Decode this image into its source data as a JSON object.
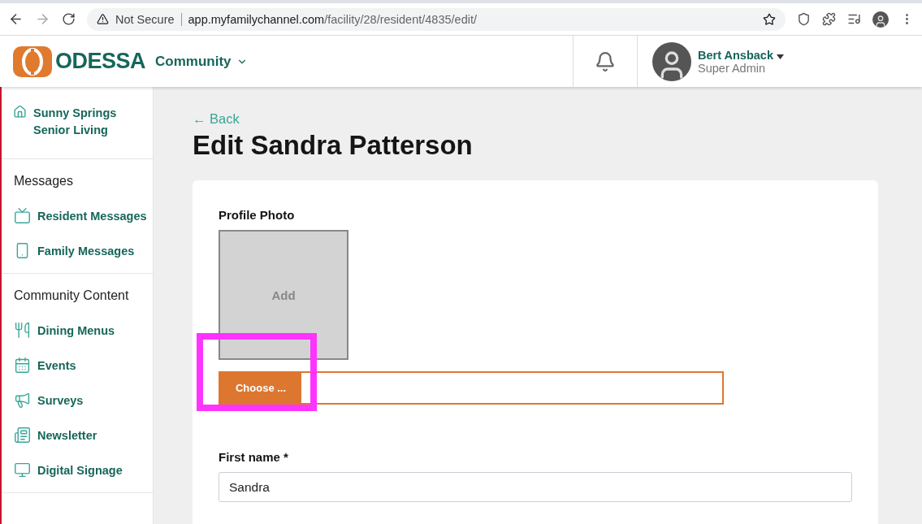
{
  "browser": {
    "security": "Not Secure",
    "url_host": "app.myfamilychannel.com",
    "url_path": "/facility/28/resident/4835/edit/"
  },
  "header": {
    "logo": "ODESSA",
    "menu": "Community",
    "user": {
      "name": "Bert Ansback",
      "role": "Super Admin"
    }
  },
  "sidebar": {
    "facility": "Sunny Springs Senior Living",
    "sections": [
      {
        "title": "Messages",
        "items": [
          {
            "label": "Resident Messages"
          },
          {
            "label": "Family Messages"
          }
        ]
      },
      {
        "title": "Community Content",
        "items": [
          {
            "label": "Dining Menus"
          },
          {
            "label": "Events"
          },
          {
            "label": "Surveys"
          },
          {
            "label": "Newsletter"
          },
          {
            "label": "Digital Signage"
          }
        ]
      }
    ]
  },
  "main": {
    "back": "← Back",
    "title": "Edit Sandra Patterson",
    "form": {
      "photo_label": "Profile Photo",
      "photo_placeholder": "Add",
      "choose_button": "Choose ...",
      "first_name_label": "First name *",
      "first_name_value": "Sandra"
    }
  }
}
